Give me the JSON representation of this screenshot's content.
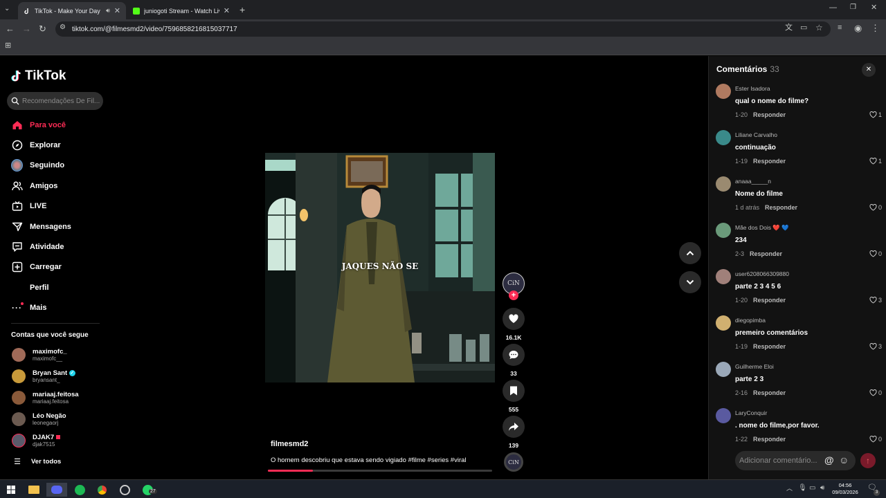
{
  "browser": {
    "tabs": [
      {
        "title": "TikTok - Make Your Day",
        "active": true
      },
      {
        "title": "juniogoti Stream - Watch Live o",
        "active": false
      }
    ],
    "url": "tiktok.com/@filmesmd2/video/7596858216815037717"
  },
  "sidebar": {
    "logo": "TikTok",
    "search_placeholder": "Recomendações De Fil...",
    "nav": [
      {
        "label": "Para você",
        "icon": "home-icon",
        "active": true
      },
      {
        "label": "Explorar",
        "icon": "compass-icon"
      },
      {
        "label": "Seguindo",
        "icon": "following-avatar-icon"
      },
      {
        "label": "Amigos",
        "icon": "friends-icon"
      },
      {
        "label": "LIVE",
        "icon": "live-icon"
      },
      {
        "label": "Mensagens",
        "icon": "messages-icon"
      },
      {
        "label": "Atividade",
        "icon": "activity-icon"
      },
      {
        "label": "Carregar",
        "icon": "upload-icon"
      },
      {
        "label": "Perfil",
        "icon": "profile-icon"
      },
      {
        "label": "Mais",
        "icon": "more-icon"
      }
    ],
    "following_title": "Contas que você segue",
    "accounts": [
      {
        "name": "maximofc_",
        "handle": "maximofc__",
        "color": "#a06a58"
      },
      {
        "name": "Bryan Sant",
        "handle": "bryansant_",
        "color": "#c89a3a",
        "verified": true
      },
      {
        "name": "mariaaj.feitosa",
        "handle": "mariaaj.feitosa",
        "color": "#8a5a3a"
      },
      {
        "name": "Léo Negão",
        "handle": "leonegaorj",
        "color": "#6b5a50"
      },
      {
        "name": "DJAK7",
        "handle": "djak7515",
        "color": "#5a5a6a",
        "live": true
      }
    ],
    "see_all": "Ver todos"
  },
  "video": {
    "caption_overlay": "JAQUES NÃO SE",
    "author": "filmesmd2",
    "description": "O homem descobriu que estava sendo vigiado #filme #series #viral",
    "progress": 0.2
  },
  "actions": {
    "avatar_text": "CiN",
    "likes": "16.1K",
    "comments": "33",
    "saves": "555",
    "shares": "139"
  },
  "comments_panel": {
    "title": "Comentários",
    "count": "33",
    "items": [
      {
        "user": "Ester Isadora",
        "text": "qual o nome do filme?",
        "date": "1-20",
        "reply": "Responder",
        "likes": "1",
        "color": "#b07a60"
      },
      {
        "user": "Liliane Carvalho",
        "text": "continuação",
        "date": "1-19",
        "reply": "Responder",
        "likes": "1",
        "color": "#3a8a8a"
      },
      {
        "user": "anaaa_____n",
        "text": "Nome do filme",
        "date": "1 d atrás",
        "reply": "Responder",
        "likes": "0",
        "color": "#9a8a70"
      },
      {
        "user": "Mãe dos Dois ❤️ 💙",
        "text": "234",
        "date": "2-3",
        "reply": "Responder",
        "likes": "0",
        "color": "#6a9a7a"
      },
      {
        "user": "user6208066309880",
        "text": "parte 2 3 4 5 6",
        "date": "1-20",
        "reply": "Responder",
        "likes": "3",
        "color": "#a0807a"
      },
      {
        "user": "diegopimba",
        "text": "premeiro comentários",
        "date": "1-19",
        "reply": "Responder",
        "likes": "3",
        "color": "#d0b070"
      },
      {
        "user": "Guilherme Eloi",
        "text": "parte 2 3",
        "date": "2-16",
        "reply": "Responder",
        "likes": "0",
        "color": "#9aa8b8"
      },
      {
        "user": "LaryConquir",
        "text": ". nome do filme,por favor.",
        "date": "1-22",
        "reply": "Responder",
        "likes": "0",
        "color": "#5a5aa0"
      }
    ],
    "input_placeholder": "Adicionar comentário..."
  },
  "taskbar": {
    "time": "04:56",
    "date": "09/03/2026",
    "whatsapp_badge": "27",
    "notification_badge": "3"
  },
  "colors": {
    "accent": "#fe2c55",
    "panel": "#121212",
    "chrome": "#35363a"
  }
}
